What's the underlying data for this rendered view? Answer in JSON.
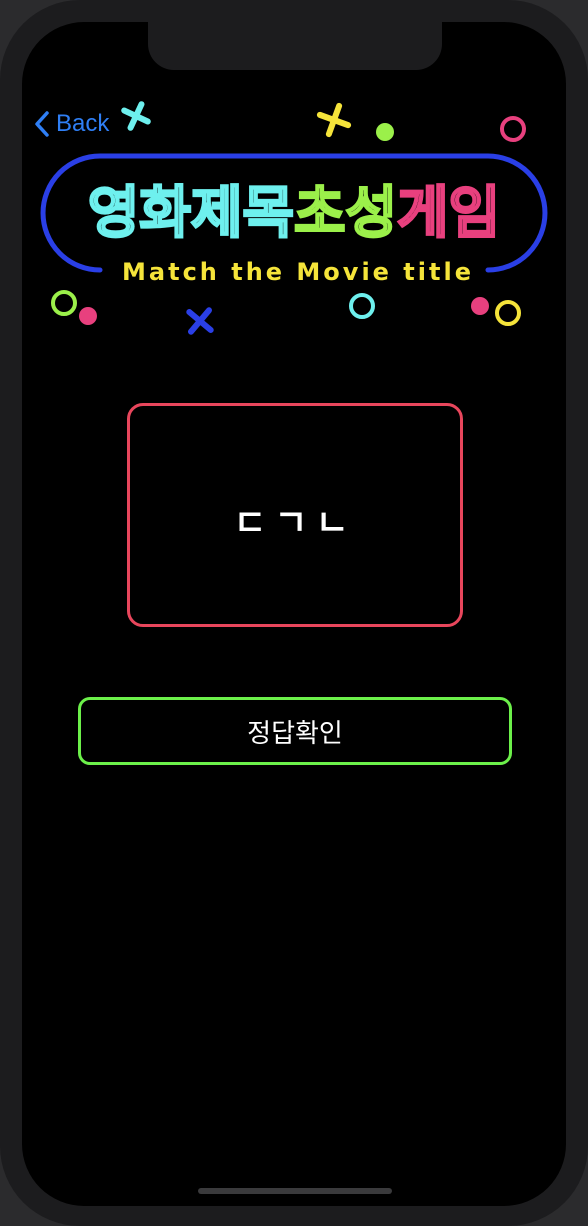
{
  "nav": {
    "back_label": "Back"
  },
  "logo": {
    "title_part1": "영화제목",
    "title_part2": "초성",
    "title_part3": "게임",
    "subtitle": "Match the Movie title"
  },
  "colors": {
    "cyan": "#6ef0ee",
    "lime": "#9bf04a",
    "pink": "#e8407e",
    "yellow": "#f5e43a",
    "blue": "#2a3fe6",
    "card_border": "#e8465c",
    "button_border": "#6cf04a",
    "back_blue": "#2f7ff5"
  },
  "hint": {
    "text": "ㄷㄱㄴ"
  },
  "actions": {
    "submit_label": "정답확인"
  }
}
